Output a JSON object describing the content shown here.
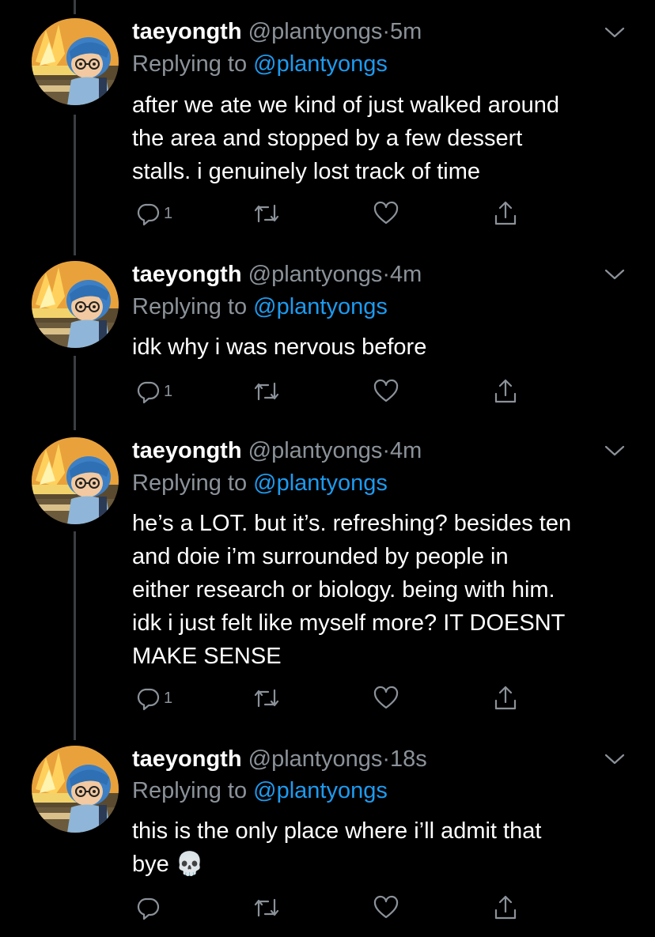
{
  "tweets": [
    {
      "name": "taeyongth",
      "handle": "@plantyongs",
      "separator": "·",
      "time": "5m",
      "reply_prefix": "Replying to",
      "reply_to": "@plantyongs",
      "lines": [
        "after we ate we kind of just walked around",
        "the area and stopped by a few dessert",
        "stalls. i genuinely lost track of time"
      ],
      "reply_count": "1"
    },
    {
      "name": "taeyongth",
      "handle": "@plantyongs",
      "separator": "·",
      "time": "4m",
      "reply_prefix": "Replying to",
      "reply_to": "@plantyongs",
      "lines": [
        "idk why i was nervous before"
      ],
      "reply_count": "1"
    },
    {
      "name": "taeyongth",
      "handle": "@plantyongs",
      "separator": "·",
      "time": "4m",
      "reply_prefix": "Replying to",
      "reply_to": "@plantyongs",
      "lines": [
        "he’s a LOT. but it’s. refreshing? besides ten",
        "and doie i’m surrounded by people in",
        "either research or biology. being with him.",
        "idk i just felt like myself more? IT DOESNT",
        "MAKE SENSE"
      ],
      "reply_count": "1"
    },
    {
      "name": "taeyongth",
      "handle": "@plantyongs",
      "separator": "·",
      "time": "18s",
      "reply_prefix": "Replying to",
      "reply_to": "@plantyongs",
      "lines": [
        "this is the only place where i’ll admit that",
        "bye 💀"
      ],
      "reply_count": ""
    }
  ],
  "colors": {
    "background": "#000000",
    "secondary_text": "#8b9299",
    "link": "#1d9bf0",
    "thread_line": "#3a3e42"
  },
  "icons": [
    "reply-icon",
    "retweet-icon",
    "like-icon",
    "share-icon",
    "chevron-down-icon"
  ]
}
